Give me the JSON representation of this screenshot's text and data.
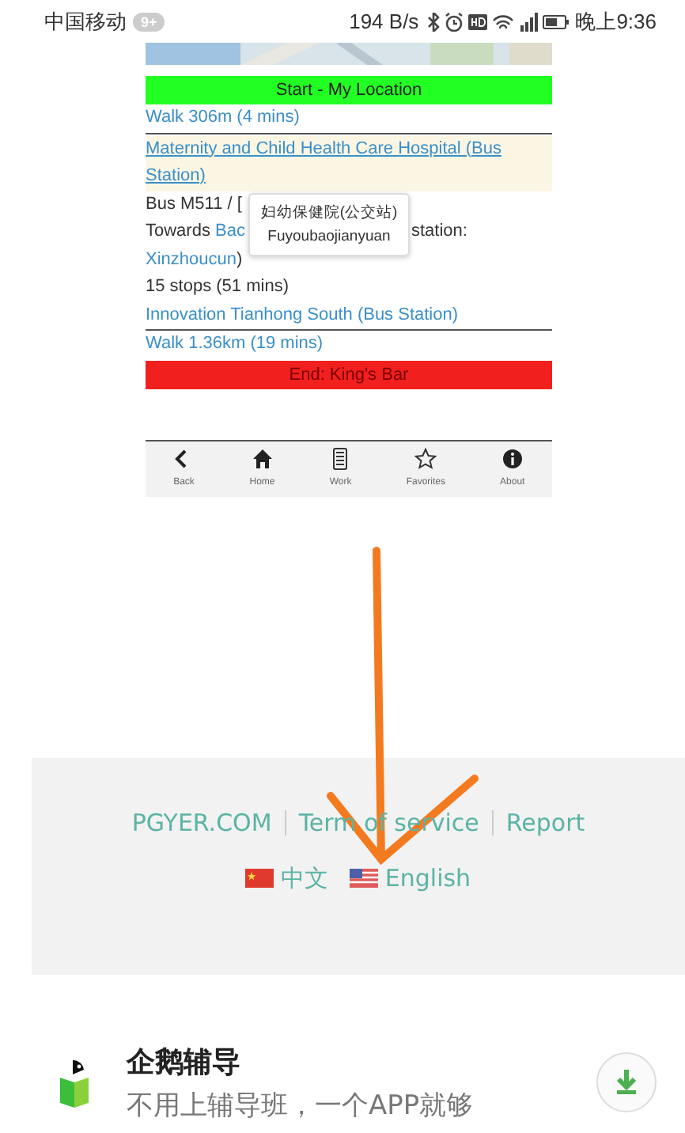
{
  "status_bar": {
    "carrier": "中国移动",
    "badge": "9+",
    "speed": "194 B/s",
    "time": "晚上9:36"
  },
  "route": {
    "start": "Start - My Location",
    "walk_to_stop": "Walk 306m (4 mins)",
    "boarding_stop": "Maternity and Child Health Care Hospital (Bus Station)",
    "bus_line": "Bus M511 / [",
    "towards": {
      "prefix": "Towards",
      "link": "Bac",
      "suffix": "station:"
    },
    "towards_end": {
      "link": "Xinzhoucun",
      "suffix": ")"
    },
    "stops": "15 stops (51 mins)",
    "arrival_stop": "Innovation Tianhong South (Bus Station)",
    "walk_to_end": "Walk 1.36km (19 mins)",
    "end": "End: King's Bar",
    "tooltip": {
      "title": "妇幼保健院(公交站)",
      "subtitle": "Fuyoubaojianyuan"
    },
    "nav": [
      {
        "kind": "back",
        "label": "Back"
      },
      {
        "kind": "home",
        "label": "Home"
      },
      {
        "kind": "work",
        "label": "Work"
      },
      {
        "kind": "star",
        "label": "Favorites"
      },
      {
        "kind": "info",
        "label": "About"
      }
    ]
  },
  "footer": {
    "links": [
      "PGYER.COM",
      "Term of service",
      "Report"
    ],
    "languages": [
      {
        "kind": "cn",
        "label": "中文"
      },
      {
        "kind": "us",
        "label": "English"
      }
    ]
  },
  "ad": {
    "title": "企鹅辅导",
    "subtitle": "不用上辅导班，一个APP就够"
  }
}
